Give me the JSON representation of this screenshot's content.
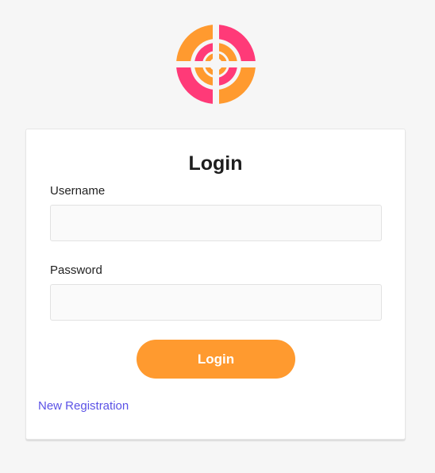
{
  "logo": {
    "icon": "target-icon",
    "colors": {
      "orange": "#ff9a2f",
      "pink": "#ff3a78"
    }
  },
  "form": {
    "title": "Login",
    "username_label": "Username",
    "username_value": "",
    "password_label": "Password",
    "password_value": "",
    "submit_label": "Login",
    "register_link": "New Registration"
  },
  "colors": {
    "accent": "#ff9a2f",
    "link": "#5b52e6",
    "background": "#f6f6f6"
  }
}
